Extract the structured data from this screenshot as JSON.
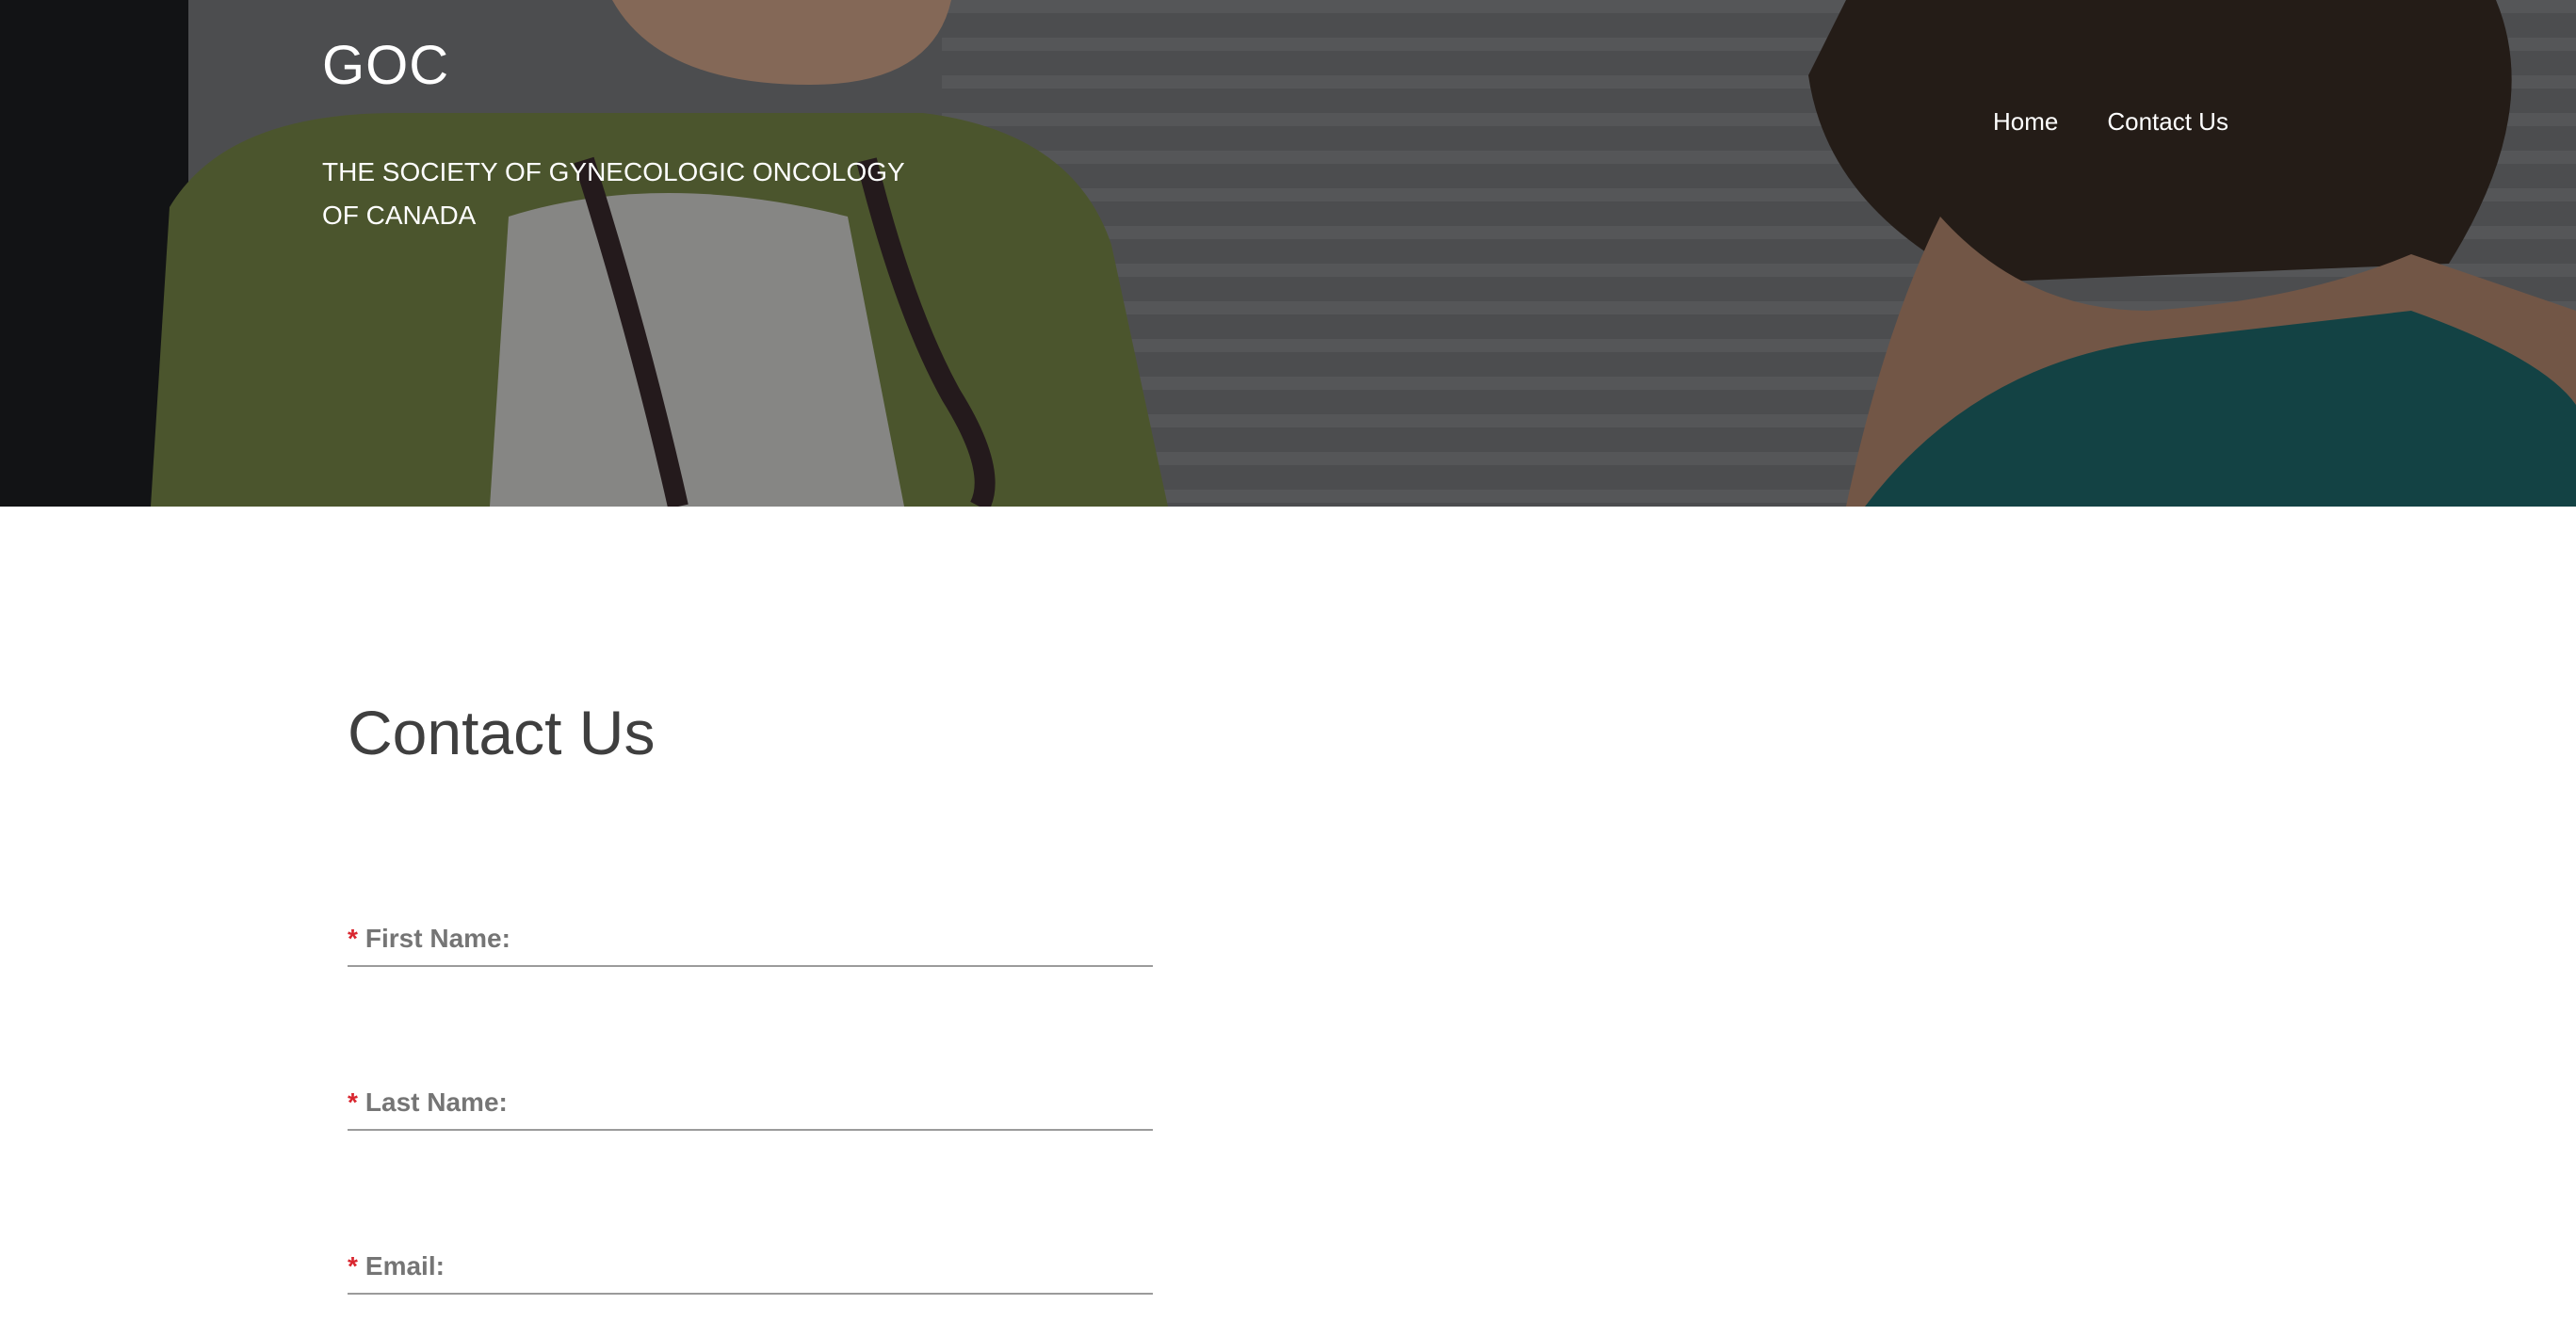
{
  "header": {
    "site_title": "GOC",
    "tagline": "THE SOCIETY OF GYNECOLOGIC ONCOLOGY OF CANADA",
    "nav": [
      {
        "label": "Home"
      },
      {
        "label": "Contact Us"
      }
    ]
  },
  "main": {
    "heading": "Contact Us",
    "form": {
      "required_marker": "*",
      "first_name_label": "First Name:",
      "last_name_label": "Last Name:",
      "email_label": "Email:",
      "first_name_value": "",
      "last_name_value": "",
      "email_value": ""
    }
  },
  "colors": {
    "required": "#d9262f",
    "heading": "#3f3f3f",
    "label": "#757575",
    "nav_text": "#ffffff"
  }
}
